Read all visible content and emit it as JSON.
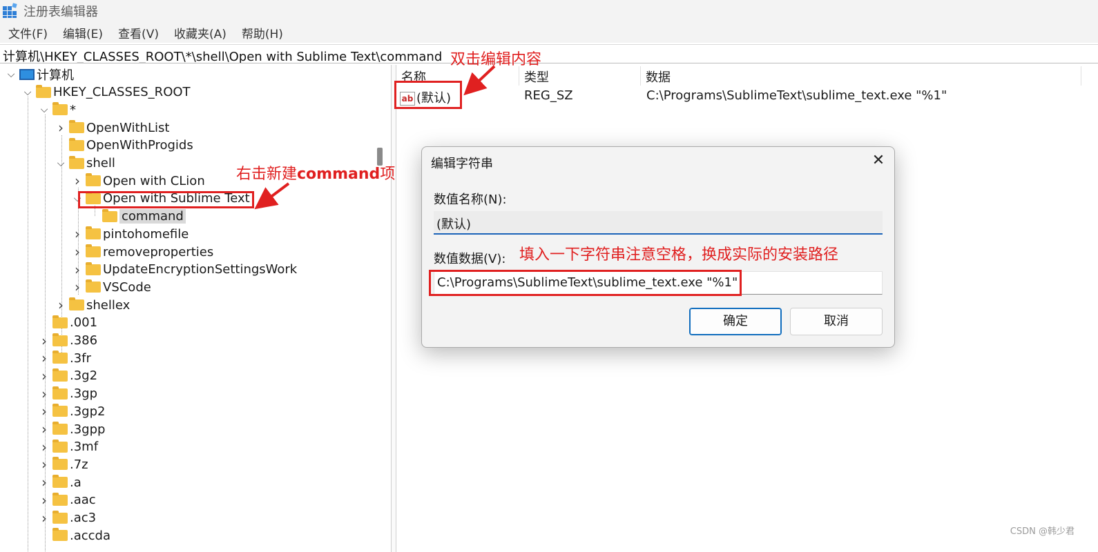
{
  "window": {
    "title": "注册表编辑器"
  },
  "menu": [
    "文件(F)",
    "编辑(E)",
    "查看(V)",
    "收藏夹(A)",
    "帮助(H)"
  ],
  "address": "计算机\\HKEY_CLASSES_ROOT\\*\\shell\\Open with Sublime Text\\command",
  "tree": {
    "items": [
      {
        "label": "计算机",
        "expander": "open",
        "icon": "computer-icon"
      },
      {
        "label": "HKEY_CLASSES_ROOT",
        "expander": "open",
        "icon": "folder-icon"
      },
      {
        "label": "*",
        "expander": "open",
        "icon": "folder-icon"
      },
      {
        "label": "OpenWithList",
        "expander": "closed",
        "icon": "folder-icon"
      },
      {
        "label": "OpenWithProgids",
        "expander": "none",
        "icon": "folder-icon"
      },
      {
        "label": "shell",
        "expander": "open",
        "icon": "folder-icon"
      },
      {
        "label": "Open with CLion",
        "expander": "closed",
        "icon": "folder-icon"
      },
      {
        "label": "Open with Sublime Text",
        "expander": "open",
        "icon": "folder-icon"
      },
      {
        "label": "command",
        "expander": "none",
        "icon": "folder-icon",
        "selected": true
      },
      {
        "label": "pintohomefile",
        "expander": "closed",
        "icon": "folder-icon"
      },
      {
        "label": "removeproperties",
        "expander": "closed",
        "icon": "folder-icon"
      },
      {
        "label": "UpdateEncryptionSettingsWork",
        "expander": "closed",
        "icon": "folder-icon"
      },
      {
        "label": "VSCode",
        "expander": "closed",
        "icon": "folder-icon"
      },
      {
        "label": "shellex",
        "expander": "closed",
        "icon": "folder-icon"
      },
      {
        "label": ".001",
        "expander": "none",
        "icon": "folder-icon"
      },
      {
        "label": ".386",
        "expander": "closed",
        "icon": "folder-icon"
      },
      {
        "label": ".3fr",
        "expander": "closed",
        "icon": "folder-icon"
      },
      {
        "label": ".3g2",
        "expander": "closed",
        "icon": "folder-icon"
      },
      {
        "label": ".3gp",
        "expander": "closed",
        "icon": "folder-icon"
      },
      {
        "label": ".3gp2",
        "expander": "closed",
        "icon": "folder-icon"
      },
      {
        "label": ".3gpp",
        "expander": "closed",
        "icon": "folder-icon"
      },
      {
        "label": ".3mf",
        "expander": "closed",
        "icon": "folder-icon"
      },
      {
        "label": ".7z",
        "expander": "closed",
        "icon": "folder-icon"
      },
      {
        "label": ".a",
        "expander": "closed",
        "icon": "folder-icon"
      },
      {
        "label": ".aac",
        "expander": "closed",
        "icon": "folder-icon"
      },
      {
        "label": ".ac3",
        "expander": "closed",
        "icon": "folder-icon"
      },
      {
        "label": ".accda",
        "expander": "none",
        "icon": "folder-icon"
      }
    ]
  },
  "values_list": {
    "columns": [
      "名称",
      "类型",
      "数据"
    ],
    "rows": [
      {
        "name": "(默认)",
        "type": "REG_SZ",
        "data": "C:\\Programs\\SublimeText\\sublime_text.exe \"%1\""
      }
    ]
  },
  "dialog": {
    "title": "编辑字符串",
    "name_label": "数值名称(N):",
    "name_value": "(默认)",
    "data_label": "数值数据(V):",
    "data_value": "C:\\Programs\\SublimeText\\sublime_text.exe \"%1\"",
    "ok_label": "确定",
    "cancel_label": "取消"
  },
  "annotations": {
    "double_click": "双击编辑内容",
    "right_click_prefix": "右击新建",
    "right_click_bold": "command",
    "right_click_suffix": "项",
    "fill_in": "填入一下字符串注意空格，换成实际的安装路径",
    "color": "#e02020"
  },
  "watermark": "CSDN @韩少君"
}
